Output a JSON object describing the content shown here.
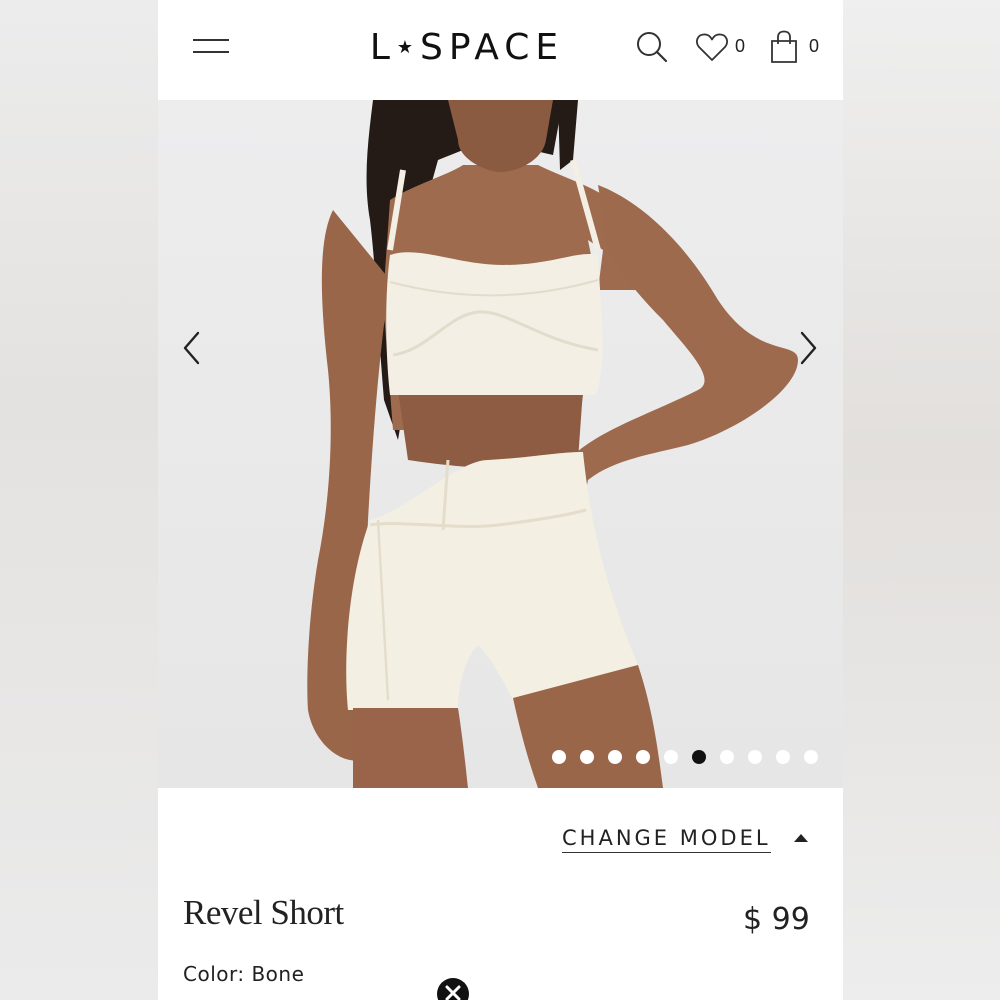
{
  "header": {
    "logo": "L★SPACE",
    "logo_left": "L",
    "logo_star": "★",
    "logo_right": "SPACE",
    "wishlist_count": "0",
    "bag_count": "0",
    "icons": [
      "menu-icon",
      "search-icon",
      "heart-icon",
      "bag-icon"
    ]
  },
  "gallery": {
    "total_images": 10,
    "active_index": 6,
    "prev_icon": "chevron-left-icon",
    "next_icon": "chevron-right-icon"
  },
  "product": {
    "change_model_label": "CHANGE MODEL",
    "name": "Revel Short",
    "price": "$ 99",
    "color_label": "Color: Bone"
  },
  "colors": {
    "background": "#ffffff",
    "text": "#1c1c1c",
    "garment": "#f3efe4"
  }
}
